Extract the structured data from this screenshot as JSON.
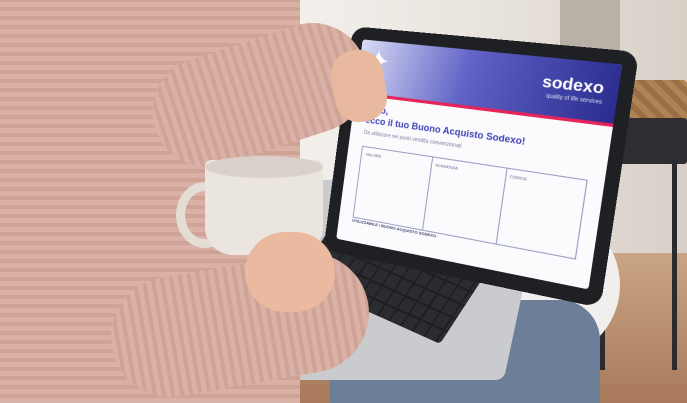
{
  "screen": {
    "logo": "sodexo",
    "logo_tagline": "quality of life services",
    "greeting_line1": "Ciao,",
    "greeting_line2": "ecco il tuo Buono Acquisto Sodexo!",
    "body_text": "Da utilizzare nei punti vendita convenzionati",
    "form_cells": [
      "VALORE",
      "SCADENZA",
      "CODICE"
    ],
    "footer_label": "UTILIZZABILE / BUONO ACQUISTO SODEXO"
  },
  "colors": {
    "brand_blue": "#2a2c8e",
    "brand_red": "#e5245a",
    "sweater": "#d9b1a6"
  }
}
